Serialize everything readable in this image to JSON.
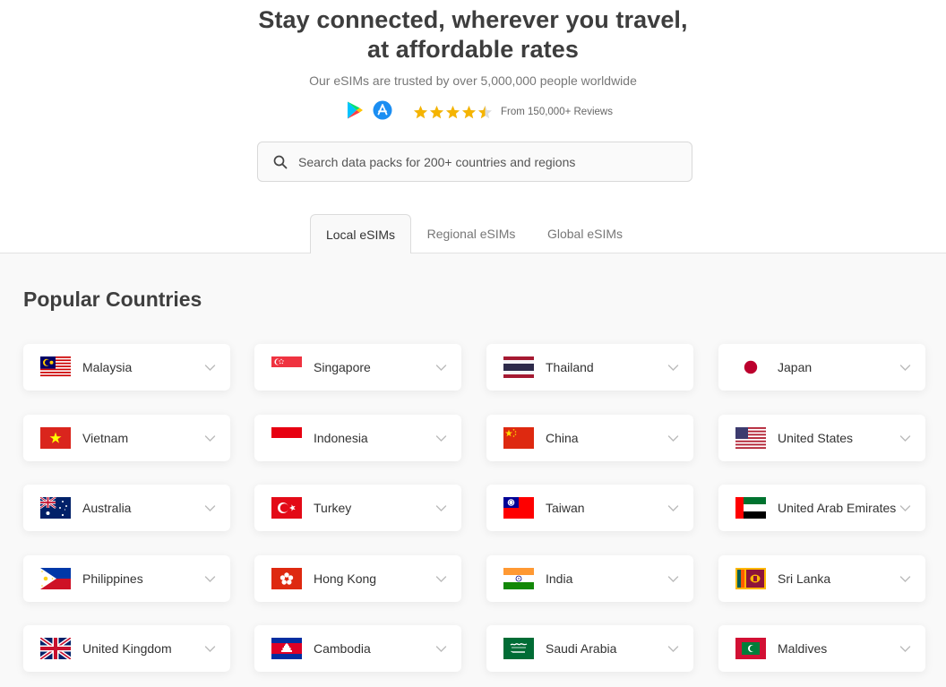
{
  "hero": {
    "title_line1": "Stay connected, wherever you travel,",
    "title_line2": "at affordable rates",
    "subtitle": "Our eSIMs are trusted by over 5,000,000 people worldwide",
    "rating_value": 4.5,
    "reviews_text": "From 150,000+ Reviews",
    "icons": [
      "google-play-icon",
      "app-store-icon"
    ]
  },
  "search": {
    "placeholder": "Search data packs for 200+ countries and regions"
  },
  "tabs": [
    {
      "label": "Local eSIMs",
      "active": true
    },
    {
      "label": "Regional eSIMs",
      "active": false
    },
    {
      "label": "Global eSIMs",
      "active": false
    }
  ],
  "section_title": "Popular Countries",
  "countries": [
    {
      "name": "Malaysia"
    },
    {
      "name": "Singapore"
    },
    {
      "name": "Thailand"
    },
    {
      "name": "Japan"
    },
    {
      "name": "Vietnam"
    },
    {
      "name": "Indonesia"
    },
    {
      "name": "China"
    },
    {
      "name": "United States"
    },
    {
      "name": "Australia"
    },
    {
      "name": "Turkey"
    },
    {
      "name": "Taiwan"
    },
    {
      "name": "United Arab Emirates"
    },
    {
      "name": "Philippines"
    },
    {
      "name": "Hong Kong"
    },
    {
      "name": "India"
    },
    {
      "name": "Sri Lanka"
    },
    {
      "name": "United Kingdom"
    },
    {
      "name": "Cambodia"
    },
    {
      "name": "Saudi Arabia"
    },
    {
      "name": "Maldives"
    }
  ],
  "colors": {
    "star": "#f5b400",
    "title": "#3d3d3d",
    "background": "#f9f9f9"
  }
}
